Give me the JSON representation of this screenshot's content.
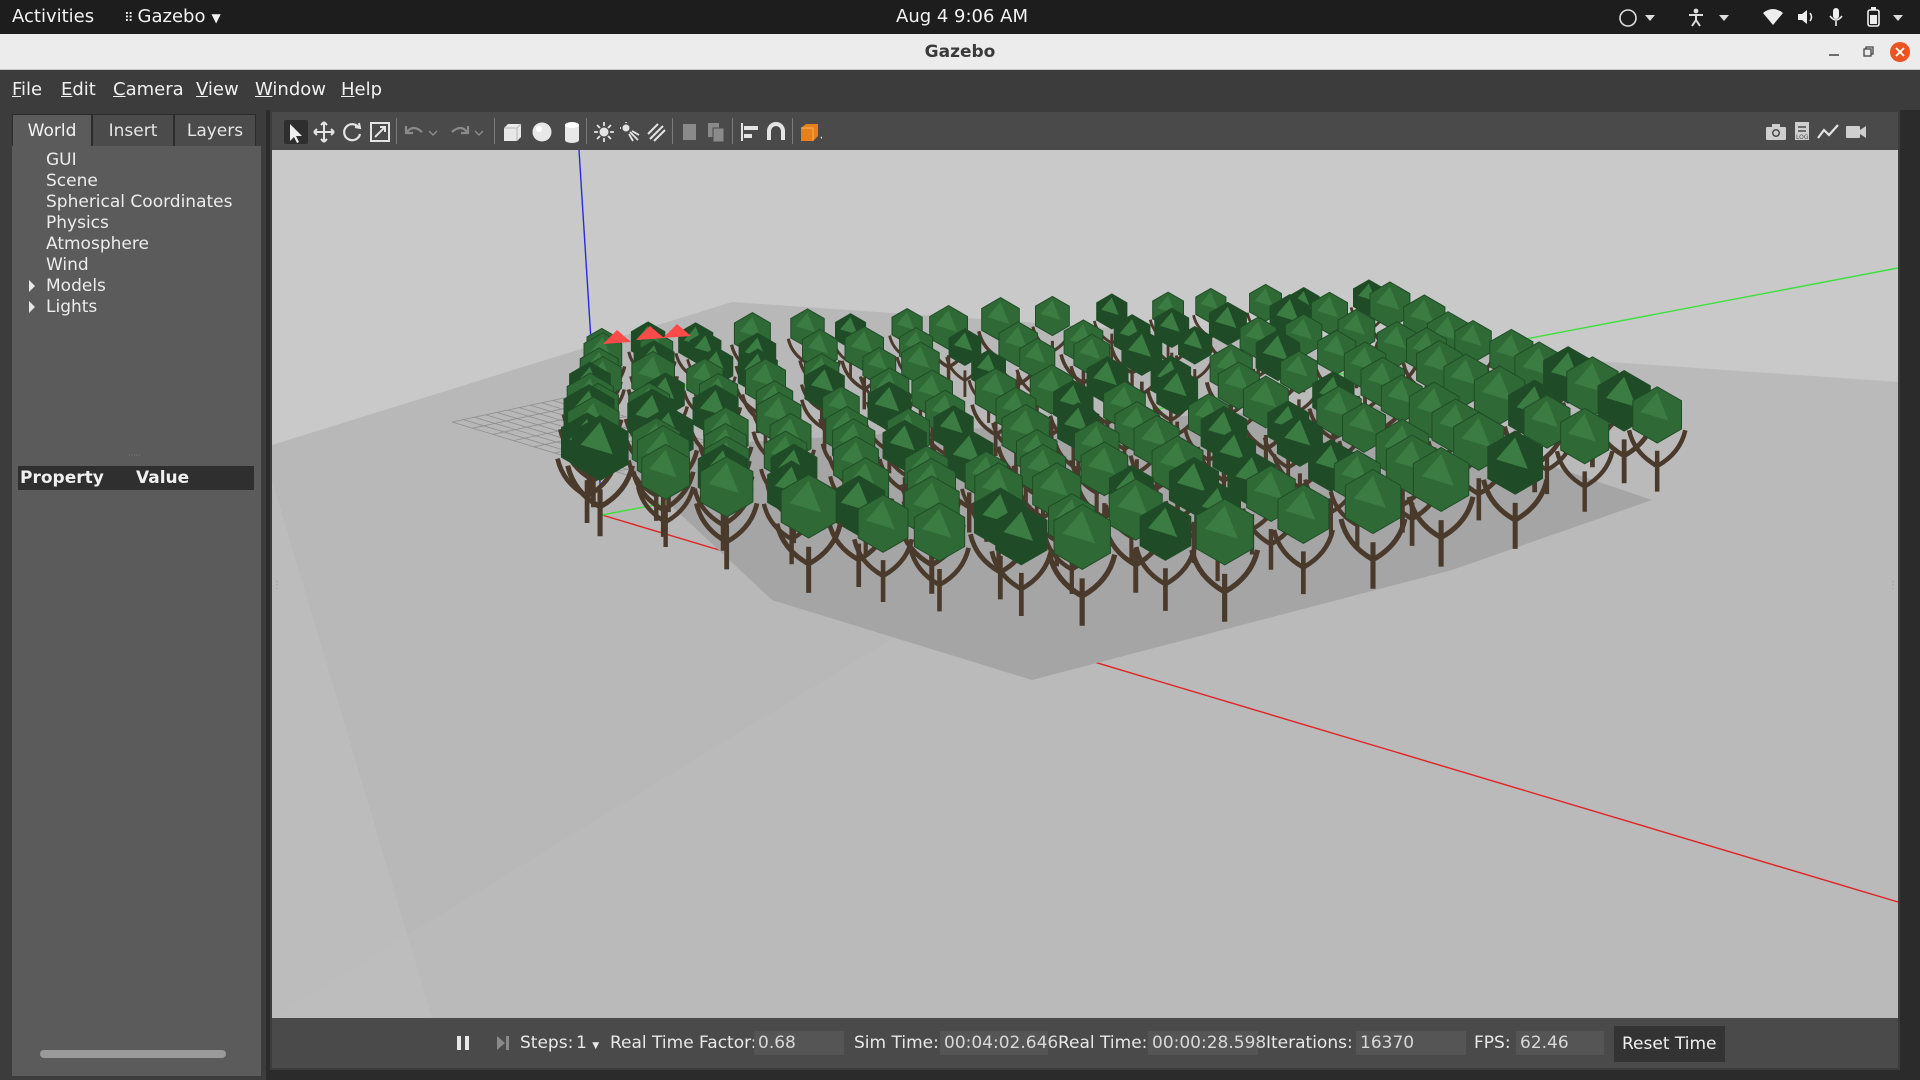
{
  "topbar": {
    "activities": "Activities",
    "app_name": "Gazebo",
    "clock": "Aug 4  9:06 AM"
  },
  "window": {
    "title": "Gazebo"
  },
  "menubar": {
    "items": [
      {
        "pre": "",
        "ul": "F",
        "post": "ile"
      },
      {
        "pre": "",
        "ul": "E",
        "post": "dit"
      },
      {
        "pre": "",
        "ul": "C",
        "post": "amera"
      },
      {
        "pre": "",
        "ul": "V",
        "post": "iew"
      },
      {
        "pre": "",
        "ul": "W",
        "post": "indow"
      },
      {
        "pre": "",
        "ul": "H",
        "post": "elp"
      }
    ]
  },
  "left_panel": {
    "tabs": [
      "World",
      "Insert",
      "Layers"
    ],
    "active_tab": "World",
    "tree": [
      "GUI",
      "Scene",
      "Spherical Coordinates",
      "Physics",
      "Atmosphere",
      "Wind",
      "Models",
      "Lights"
    ],
    "properties": {
      "col_property": "Property",
      "col_value": "Value"
    }
  },
  "toolbar": {
    "tools": [
      "select-icon",
      "translate-icon",
      "rotate-icon",
      "scale-icon",
      "undo-icon",
      "redo-icon",
      "box-icon",
      "sphere-icon",
      "cylinder-icon",
      "point-light-icon",
      "spot-light-icon",
      "directional-light-icon",
      "copy-icon",
      "paste-icon",
      "align-icon",
      "snap-icon",
      "view-angle-icon"
    ],
    "right_tools": [
      "screenshot-icon",
      "log-icon",
      "plot-icon",
      "video-icon"
    ]
  },
  "bottombar": {
    "steps_label": "Steps:",
    "steps_value": "1",
    "rtf_label": "Real Time Factor:",
    "rtf_value": "0.68",
    "sim_time_label": "Sim Time:",
    "sim_time_value": "00:04:02.646",
    "real_time_label": "Real Time:",
    "real_time_value": "00:00:28.598",
    "iterations_label": "Iterations:",
    "iterations_value": "16370",
    "fps_label": "FPS:",
    "fps_value": "62.46",
    "reset_label": "Reset Time"
  },
  "colors": {
    "canopy": "#2f6a36",
    "canopy_dark": "#1f4c26",
    "trunk": "#4a3a2c",
    "axis_x": "#e02020",
    "axis_y": "#40e040",
    "axis_z": "#2020e0",
    "selected": "#ff4a4a"
  }
}
